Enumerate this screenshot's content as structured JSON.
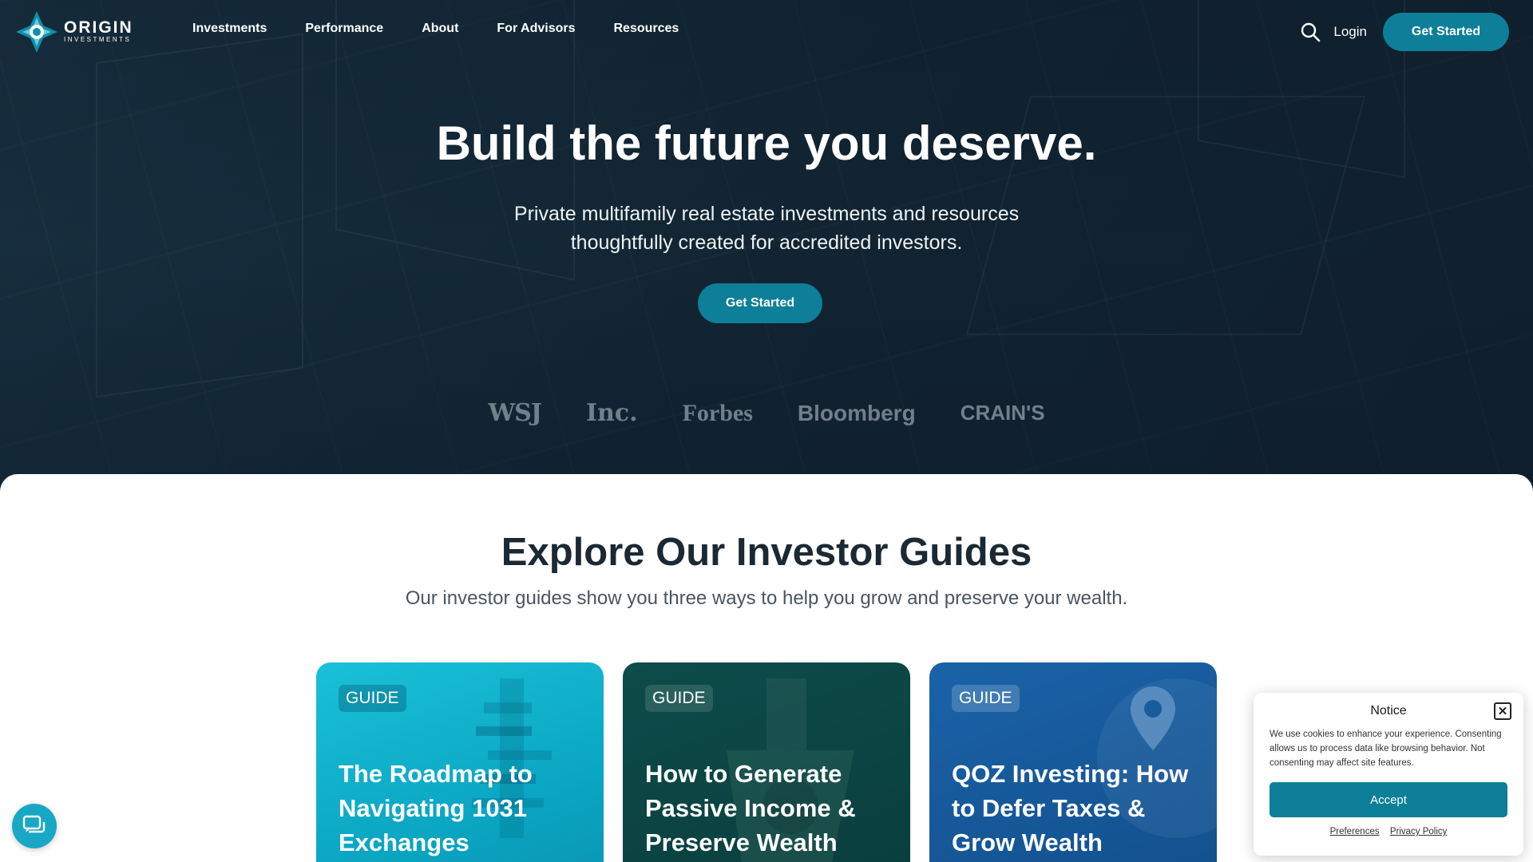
{
  "brand": {
    "name": "ORIGIN",
    "sub": "INVESTMENTS"
  },
  "nav": {
    "links": [
      "Investments",
      "Performance",
      "About",
      "For Advisors",
      "Resources"
    ],
    "login": "Login",
    "cta": "Get Started"
  },
  "hero": {
    "title": "Build the future you deserve.",
    "subtitle_line1": "Private multifamily real estate investments and resources",
    "subtitle_line2": "thoughtfully created for accredited investors.",
    "cta": "Get Started",
    "press": [
      "WSJ",
      "Inc.",
      "Forbes",
      "Bloomberg",
      "CRAIN'S"
    ]
  },
  "guides": {
    "title": "Explore Our Investor Guides",
    "subtitle": "Our investor guides show you three ways to help you grow and preserve your wealth.",
    "cards": [
      {
        "badge": "GUIDE",
        "title": "The Roadmap to Navigating 1031 Exchanges",
        "color": "#12b4cf"
      },
      {
        "badge": "GUIDE",
        "title": "How to Generate Passive Income & Preserve Wealth",
        "color": "#0b4444"
      },
      {
        "badge": "GUIDE",
        "title": "QOZ Investing: How to Defer Taxes & Grow Wealth",
        "color": "#175c9c"
      }
    ]
  },
  "cookie": {
    "title": "Notice",
    "body": "We use cookies to enhance your experience. Consenting allows us to process data like browsing behavior. Not consenting may affect site features.",
    "accept": "Accept",
    "preferences": "Preferences",
    "privacy": "Privacy Policy"
  },
  "colors": {
    "accent": "#0d7f98",
    "hero_bg": "#16293a",
    "heading": "#1a2934"
  },
  "icons": [
    "logo-icon",
    "search-icon",
    "close-icon",
    "chat-icon"
  ]
}
